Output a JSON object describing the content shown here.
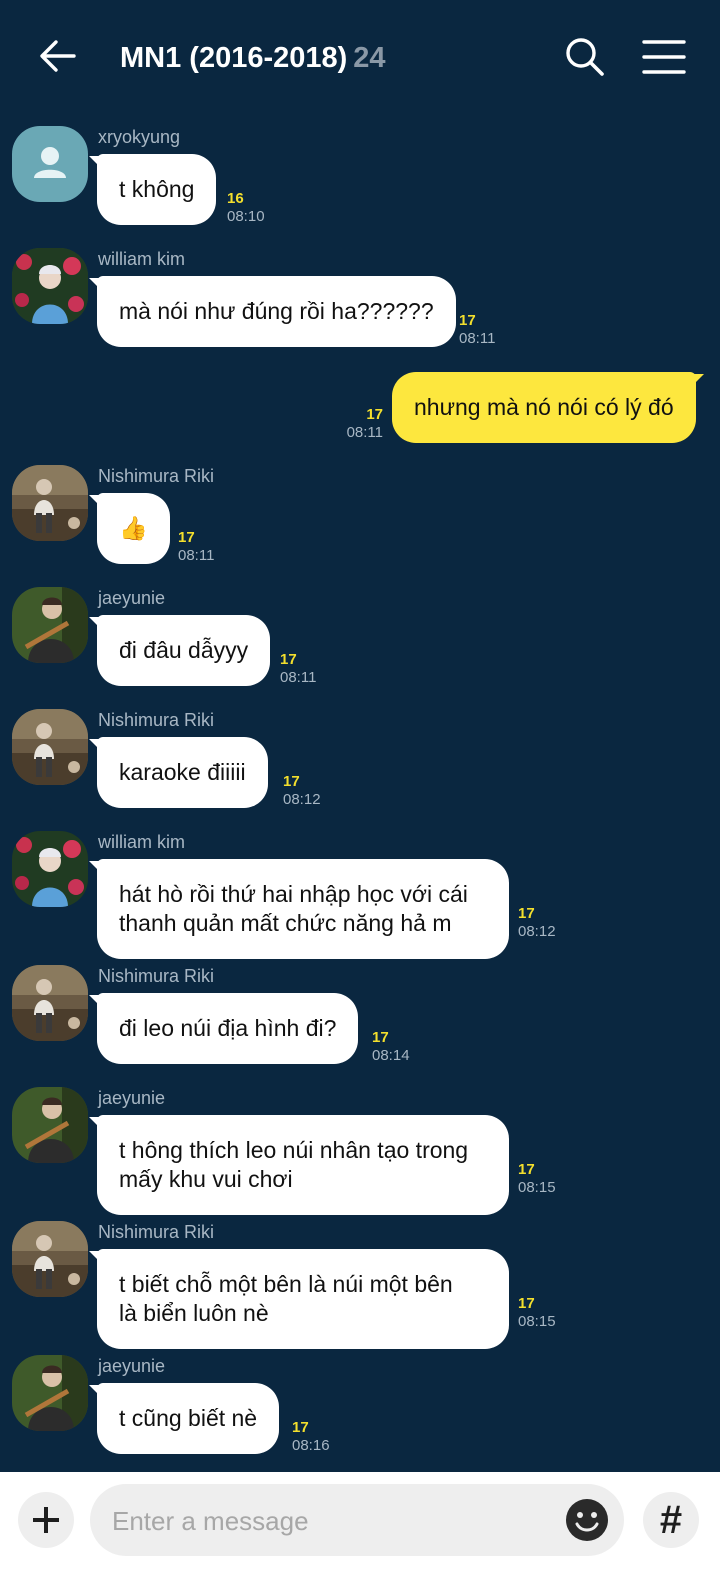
{
  "header": {
    "title": "MN1 (2016-2018)",
    "member_count": "24",
    "icons": {
      "back": "back-arrow-icon",
      "search": "search-icon",
      "menu": "hamburger-menu-icon"
    }
  },
  "messages": [
    {
      "sender": "xryokyung",
      "text": "t không",
      "unread": "16",
      "time": "08:10",
      "direction": "incoming",
      "avatar": "default-profile-icon"
    },
    {
      "sender": "william kim",
      "text": "mà nói như đúng rồi ha??????",
      "unread": "17",
      "time": "08:11",
      "direction": "incoming",
      "avatar": "profile-photo"
    },
    {
      "sender": "",
      "text": "nhưng mà nó nói có lý đó",
      "unread": "17",
      "time": "08:11",
      "direction": "outgoing"
    },
    {
      "sender": "Nishimura Riki",
      "text": "👍",
      "unread": "17",
      "time": "08:11",
      "direction": "incoming",
      "avatar": "profile-photo"
    },
    {
      "sender": "jaeyunie",
      "text": "đi đâu dẫyyy",
      "unread": "17",
      "time": "08:11",
      "direction": "incoming",
      "avatar": "profile-photo"
    },
    {
      "sender": "Nishimura Riki",
      "text": "karaoke điiiii",
      "unread": "17",
      "time": "08:12",
      "direction": "incoming",
      "avatar": "profile-photo"
    },
    {
      "sender": "william kim",
      "text": "hát hò rồi thứ hai nhập học với cái\nthanh quản mất chức năng hả m",
      "unread": "17",
      "time": "08:12",
      "direction": "incoming",
      "avatar": "profile-photo"
    },
    {
      "sender": "Nishimura Riki",
      "text": "đi leo núi địa hình đi?",
      "unread": "17",
      "time": "08:14",
      "direction": "incoming",
      "avatar": "profile-photo"
    },
    {
      "sender": "jaeyunie",
      "text": "t hông thích leo núi nhân tạo trong\nmấy khu vui chơi",
      "unread": "17",
      "time": "08:15",
      "direction": "incoming",
      "avatar": "profile-photo"
    },
    {
      "sender": "Nishimura Riki",
      "text": "t biết chỗ một bên là núi một bên\nlà biển luôn nè",
      "unread": "17",
      "time": "08:15",
      "direction": "incoming",
      "avatar": "profile-photo"
    },
    {
      "sender": "jaeyunie",
      "text": "t cũng biết nè",
      "unread": "17",
      "time": "08:16",
      "direction": "incoming",
      "avatar": "profile-photo"
    }
  ],
  "composer": {
    "placeholder": "Enter a message",
    "hash_label": "#",
    "icons": {
      "add": "plus-icon",
      "emoji": "emoji-smiley-icon",
      "hash": "hashtag-icon"
    }
  },
  "colors": {
    "background": "#0a2740",
    "incoming_bubble": "#ffffff",
    "outgoing_bubble": "#fde73e",
    "unread_count": "#f3df2d",
    "meta_text": "#a8b7c4"
  }
}
